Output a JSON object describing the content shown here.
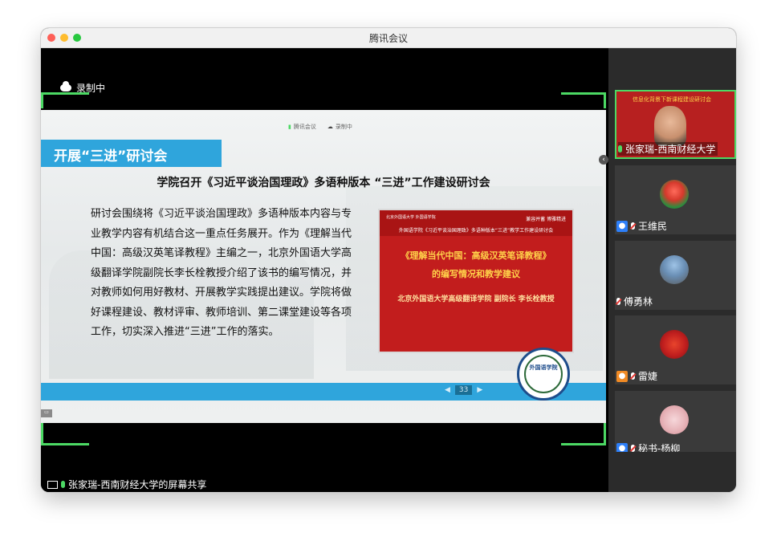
{
  "window": {
    "title": "腾讯会议"
  },
  "recording": {
    "label": "录制中"
  },
  "slide": {
    "mini_bar": {
      "left": "腾讯会议",
      "right": "录制中"
    },
    "heading": "开展“三进”研讨会",
    "subtitle": "学院召开《习近平谈治国理政》多语种版本 “三进”工作建设研讨会",
    "body": "研讨会围绕将《习近平谈治国理政》多语种版本内容与专业教学内容有机结合这一重点任务展开。作为《理解当代中国：高级汉英笔译教程》主编之一，北京外国语大学高级翻译学院副院长李长栓教授介绍了该书的编写情况，并对教师如何用好教材、开展教学实践提出建议。学院将做好课程建设、教材评审、教师培训、第二课堂建设等各项工作，切实深入推进“三进”工作的落实。",
    "inset": {
      "logo": "北京外国语大学 外国语学院",
      "motto": "兼容并蓄 博雅精进",
      "header_line": "外国语学院《习近平谈治国理政》多语种版本“三进”教学工作建设研讨会",
      "title_line1": "《理解当代中国：高级汉英笔译教程》",
      "title_line2": "的编写情况和教学建议",
      "author": "北京外国语大学高级翻译学院 副院长 李长栓教授"
    },
    "page_number": "33",
    "seal_text": "外国语学院"
  },
  "share": {
    "label": "张家瑞-西南财经大学的屏幕共享"
  },
  "participants": [
    {
      "name": "张家瑞-西南财经大学",
      "caption": "信息化背景下新课程建设研讨会",
      "speaking": true
    },
    {
      "name": "王维民",
      "badge": "blue"
    },
    {
      "name": "傅勇林",
      "badge": "none"
    },
    {
      "name": "雷婕",
      "badge": "orange"
    },
    {
      "name": "秘书-杨柳",
      "badge": "blue"
    }
  ],
  "colors": {
    "accent_green": "#4cd964",
    "slide_blue": "#2fa5dc",
    "inset_red": "#c21d1d"
  }
}
